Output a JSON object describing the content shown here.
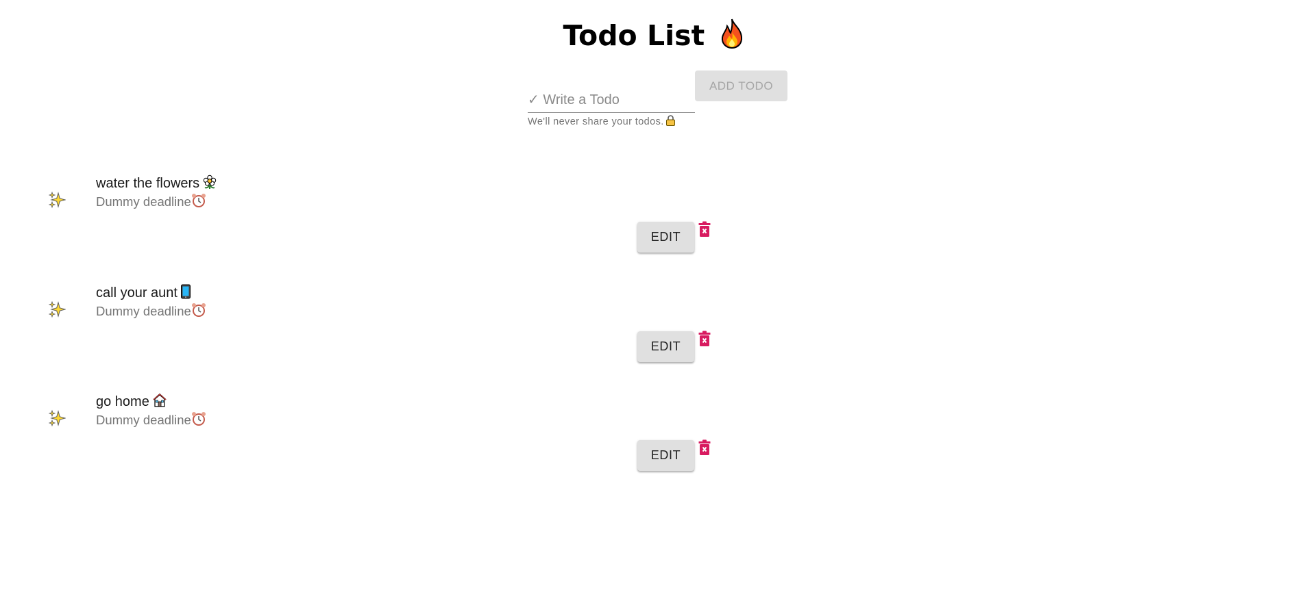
{
  "header": {
    "title": "Todo List",
    "title_icon": "fire-icon"
  },
  "add_form": {
    "input_placeholder": "✓ Write a Todo",
    "input_value": "",
    "helper_text": "We'll never share your todos.",
    "helper_icon": "lock-icon",
    "add_button_label": "ADD TODO"
  },
  "todos": [
    {
      "icon": "sparkles-icon",
      "text": "water the flowers",
      "text_icon": "flower-icon",
      "deadline": "Dummy deadline",
      "deadline_icon": "alarm-clock-icon",
      "edit_label": "EDIT",
      "delete_icon": "trash-icon"
    },
    {
      "icon": "sparkles-icon",
      "text": "call your aunt",
      "text_icon": "mobile-phone-icon",
      "deadline": "Dummy deadline",
      "deadline_icon": "alarm-clock-icon",
      "edit_label": "EDIT",
      "delete_icon": "trash-icon"
    },
    {
      "icon": "sparkles-icon",
      "text": "go home",
      "text_icon": "house-icon",
      "deadline": "Dummy deadline",
      "deadline_icon": "alarm-clock-icon",
      "edit_label": "EDIT",
      "delete_icon": "trash-icon"
    }
  ],
  "colors": {
    "delete_icon": "#d81b60",
    "button_bg": "#e0e0e0",
    "disabled_text": "#a6a6a6",
    "secondary_text": "#757575"
  }
}
